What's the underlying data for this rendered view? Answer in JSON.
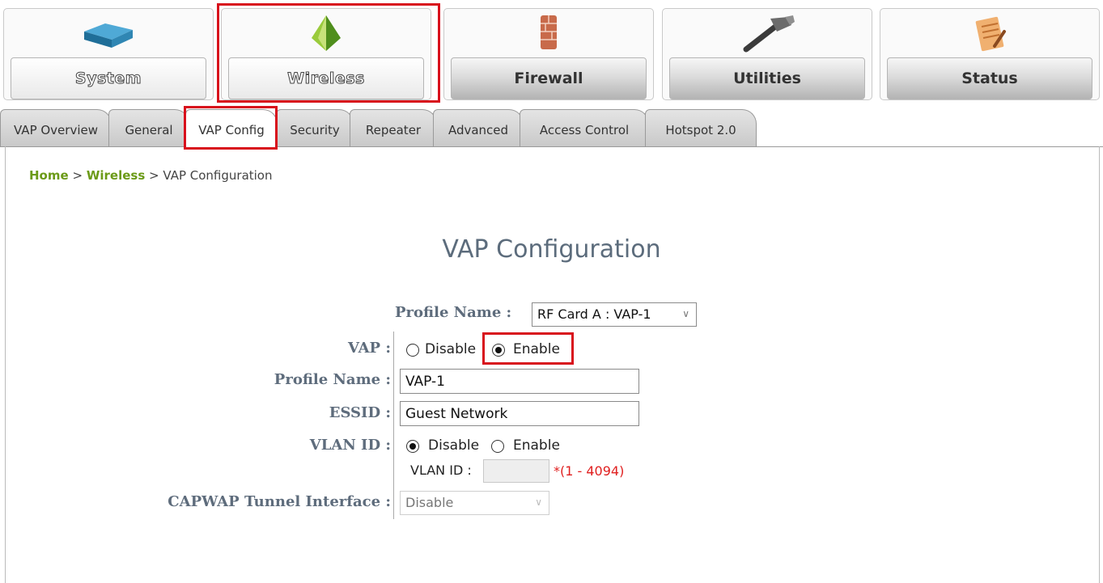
{
  "nav": {
    "system": "System",
    "wireless": "Wireless",
    "firewall": "Firewall",
    "utilities": "Utilities",
    "status": "Status"
  },
  "tabs": [
    "VAP Overview",
    "General",
    "VAP Config",
    "Security",
    "Repeater",
    "Advanced",
    "Access Control",
    "Hotspot 2.0"
  ],
  "breadcrumb": {
    "home": "Home",
    "sep1": ">",
    "wireless": "Wireless",
    "sep2": ">",
    "current": "VAP Configuration"
  },
  "page_title": "VAP Configuration",
  "form": {
    "profile_select_label": "Profile Name :",
    "profile_select_value": "RF Card A : VAP-1",
    "vap_label": "VAP :",
    "vap_disable": "Disable",
    "vap_enable": "Enable",
    "profile_name_label": "Profile Name :",
    "profile_name_value": "VAP-1",
    "essid_label": "ESSID :",
    "essid_value": "Guest Network",
    "vlan_label": "VLAN ID :",
    "vlan_disable": "Disable",
    "vlan_enable": "Enable",
    "vlan_id_sub_label": "VLAN ID :",
    "vlan_range": "*(1 - 4094)",
    "capwap_label": "CAPWAP Tunnel Interface :",
    "capwap_value": "Disable"
  },
  "colors": {
    "highlight": "#d8101c",
    "link_green": "#6b9a17",
    "label_slate": "#5e6c7c",
    "required_red": "#e02020"
  }
}
